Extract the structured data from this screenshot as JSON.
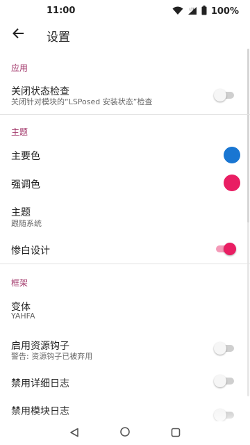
{
  "status_bar": {
    "time": "11:00",
    "battery_text": "100%",
    "icons": [
      "wifi-icon",
      "lte-signal-icon",
      "battery-icon"
    ]
  },
  "app_bar": {
    "back_icon": "arrow-left-icon",
    "title": "设置"
  },
  "sections": {
    "app": {
      "title": "应用",
      "items": [
        {
          "title": "关闭状态检查",
          "subtitle": "关闭针对模块的“LSPosed 安装状态”检查",
          "switch_on": false
        }
      ]
    },
    "theme": {
      "title": "主题",
      "items": [
        {
          "title": "主要色",
          "color": "#1976d2"
        },
        {
          "title": "强调色",
          "color": "#e91e63"
        },
        {
          "title": "主题",
          "subtitle": "跟随系统"
        },
        {
          "title": "惨白设计",
          "switch_on": true
        }
      ]
    },
    "framework": {
      "title": "框架",
      "items": [
        {
          "title": "变体",
          "subtitle": "YAHFA"
        },
        {
          "title": "启用资源钩子",
          "subtitle": "警告: 资源钩子已被弃用",
          "switch_on": false
        },
        {
          "title": "禁用详细日志",
          "switch_on": false
        },
        {
          "title": "禁用模块日志",
          "switch_on": false
        }
      ]
    }
  },
  "colors": {
    "section_title": "#a33a6c",
    "accent": "#e91e63",
    "primary": "#1976d2"
  },
  "nav_bar": {
    "icons": [
      "back-triangle-icon",
      "home-circle-icon",
      "recents-square-icon"
    ]
  }
}
